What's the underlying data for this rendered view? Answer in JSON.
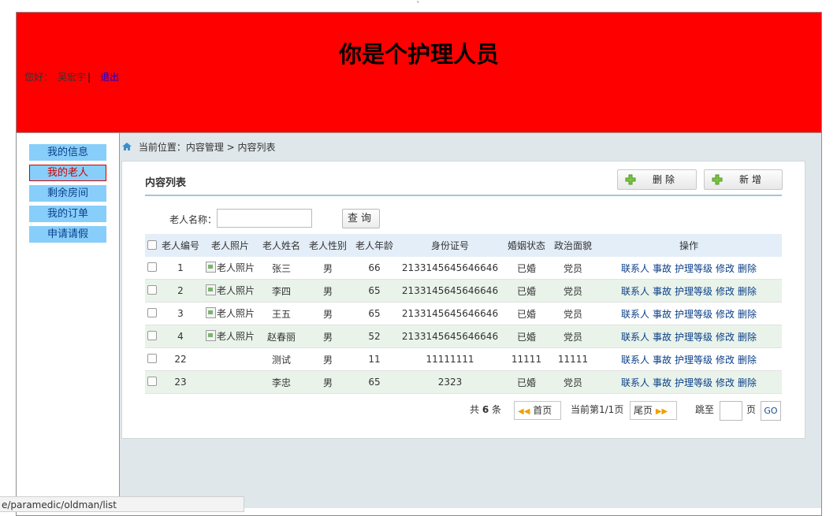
{
  "tick": "`",
  "header": {
    "title": "你是个护理人员",
    "greeting": "您好：",
    "username": "吴宏宇",
    "separator": "|",
    "logout": "退出"
  },
  "nav": {
    "items": [
      {
        "label": "我的信息",
        "active": false
      },
      {
        "label": "我的老人",
        "active": true
      },
      {
        "label": "剩余房间",
        "active": false
      },
      {
        "label": "我的订单",
        "active": false
      },
      {
        "label": "申请请假",
        "active": false
      }
    ]
  },
  "breadcrumb": "当前位置：内容管理 > 内容列表",
  "panel": {
    "title": "内容列表",
    "delete_label": "删除",
    "add_label": "新增"
  },
  "search": {
    "label": "老人名称：",
    "value": "",
    "placeholder": "",
    "button": "查询"
  },
  "table": {
    "columns": [
      "老人编号",
      "老人照片",
      "老人姓名",
      "老人性别",
      "老人年龄",
      "身份证号",
      "婚姻状态",
      "政治面貌",
      "操作"
    ],
    "photo_alt": "老人照片",
    "actions": [
      "联系人",
      "事故",
      "护理等级",
      "修改",
      "删除"
    ],
    "rows": [
      {
        "id": "1",
        "photo": true,
        "name": "张三",
        "gender": "男",
        "age": "66",
        "idcard": "2133145645646646",
        "marital": "已婚",
        "political": "党员"
      },
      {
        "id": "2",
        "photo": true,
        "name": "李四",
        "gender": "男",
        "age": "65",
        "idcard": "2133145645646646",
        "marital": "已婚",
        "political": "党员"
      },
      {
        "id": "3",
        "photo": true,
        "name": "王五",
        "gender": "男",
        "age": "65",
        "idcard": "2133145645646646",
        "marital": "已婚",
        "political": "党员"
      },
      {
        "id": "4",
        "photo": true,
        "name": "赵春丽",
        "gender": "男",
        "age": "52",
        "idcard": "2133145645646646",
        "marital": "已婚",
        "political": "党员"
      },
      {
        "id": "22",
        "photo": false,
        "name": "测试",
        "gender": "男",
        "age": "11",
        "idcard": "11111111",
        "marital": "11111",
        "political": "11111"
      },
      {
        "id": "23",
        "photo": false,
        "name": "李忠",
        "gender": "男",
        "age": "65",
        "idcard": "2323",
        "marital": "已婚",
        "political": "党员"
      }
    ]
  },
  "pager": {
    "total_prefix": "共",
    "total": "6",
    "total_suffix": "条",
    "first": "首页",
    "current": "当前第1/1页",
    "last": "尾页",
    "goto_prefix": "跳至",
    "goto_suffix": "页",
    "go": "GO"
  },
  "status_url": "e/paramedic/oldman/list",
  "colors": {
    "header_bg": "#ff0000",
    "nav_bg": "#87cefa",
    "main_bg": "#dfe7ea",
    "row_alt": "#e9f3ea",
    "link": "#0a3e88"
  }
}
